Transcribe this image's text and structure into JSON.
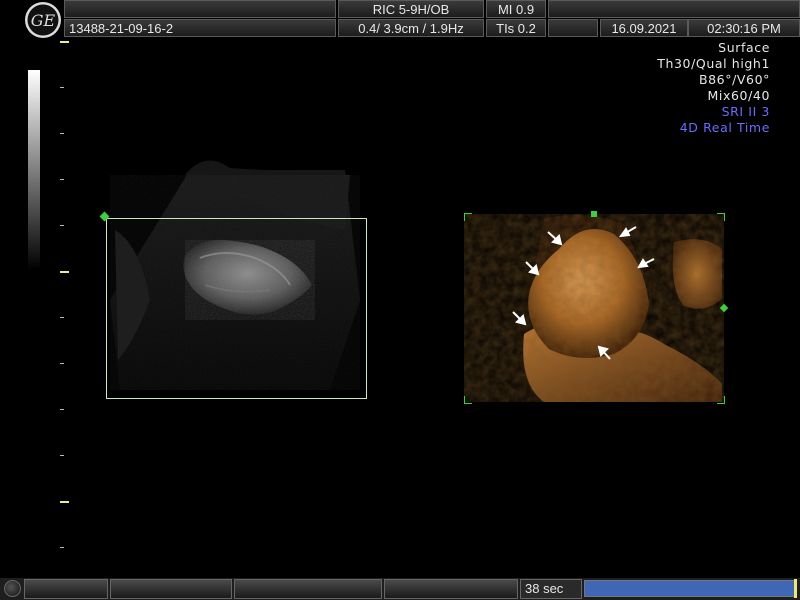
{
  "header": {
    "logo_text": "GE",
    "probe": "RIC 5-9H/OB",
    "mi": "MI  0.9",
    "patient_id": "13488-21-09-16-2",
    "depth_freq": "0.4/ 3.9cm / 1.9Hz",
    "tis": "TIs  0.2",
    "date": "16.09.2021",
    "time": "02:30:16 PM"
  },
  "info_panel": {
    "lines": [
      "Surface",
      "Th30/Qual high1",
      "B86°/V60°",
      "Mix60/40"
    ],
    "highlight_lines": [
      "SRI II 3",
      "4D Real Time"
    ],
    "highlight_color": "#6b6bff"
  },
  "status_bar": {
    "timer": "38 sec",
    "progress": 1.0,
    "progress_color": "#3e67b5"
  },
  "colors": {
    "roi_green": "#3bd13b",
    "render_orange": "#c0752c"
  }
}
